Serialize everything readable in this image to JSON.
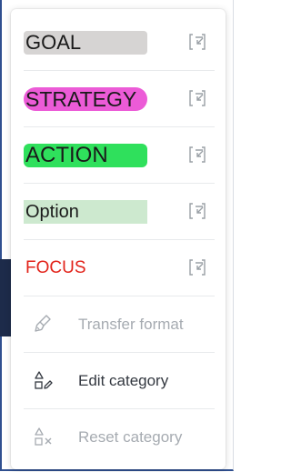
{
  "categories": [
    {
      "label": "GOAL",
      "color": "#d6d4d3",
      "style": "rounded-block"
    },
    {
      "label": "STRATEGY",
      "color": "#ec5bd7",
      "style": "pill"
    },
    {
      "label": "ACTION",
      "color": "#2fe05c",
      "style": "rounded-block"
    },
    {
      "label": "Option",
      "color": "#cde9cf",
      "style": "block"
    },
    {
      "label": "FOCUS",
      "color": "#e2231a",
      "style": "text-color"
    }
  ],
  "actions": {
    "transfer_format": {
      "label": "Transfer format",
      "icon": "brush-icon",
      "enabled": false
    },
    "edit_category": {
      "label": "Edit category",
      "icon": "shapes-edit-icon",
      "enabled": true
    },
    "reset_category": {
      "label": "Reset category",
      "icon": "shapes-reset-icon",
      "enabled": false
    }
  },
  "colors": {
    "disabled_text": "#a6abb1",
    "enabled_text": "#333840",
    "focus_text": "#e2231a"
  }
}
